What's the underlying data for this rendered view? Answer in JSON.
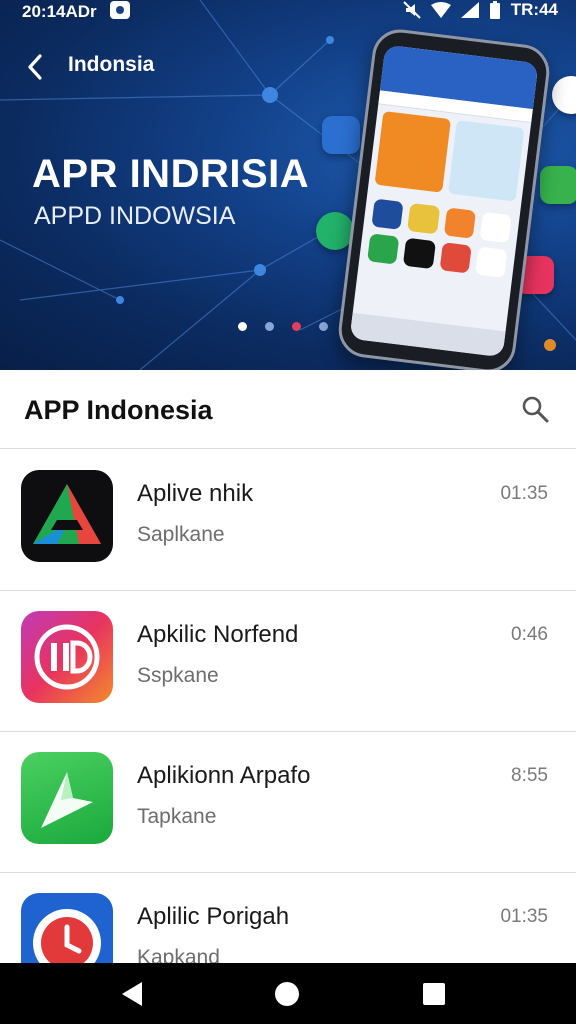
{
  "status_bar": {
    "left_text": "20:14ADr",
    "time": "TR:44"
  },
  "app_bar": {
    "title": "Indonsia"
  },
  "hero": {
    "title": "APR INDRISIA",
    "subtitle": "APPD INDOWSIA",
    "page_indicator": {
      "count": 4,
      "active": 0
    }
  },
  "section": {
    "title": "APP Indonesia"
  },
  "apps": [
    {
      "name": "Aplive nhik",
      "subtitle": "Saplkane",
      "time": "01:35",
      "icon": "triangle-logo-icon"
    },
    {
      "name": "Apkilic Norfend",
      "subtitle": "Sspkane",
      "time": "0:46",
      "icon": "hd-logo-icon"
    },
    {
      "name": "Aplikionn Arpafo",
      "subtitle": "Tapkane",
      "time": "8:55",
      "icon": "arrow-logo-icon"
    },
    {
      "name": "Aplilic Porigah",
      "subtitle": "Kapkand",
      "time": "01:35",
      "icon": "clock-logo-icon"
    }
  ],
  "colors": {
    "hero_dark": "#0b2a5e",
    "hero_mid": "#1f5fb5",
    "navbar": "#000000"
  },
  "icons": {
    "back": "back-arrow-icon",
    "search": "search-icon",
    "nav_back": "nav-back-icon",
    "nav_home": "nav-home-icon",
    "nav_recents": "nav-recents-icon"
  }
}
